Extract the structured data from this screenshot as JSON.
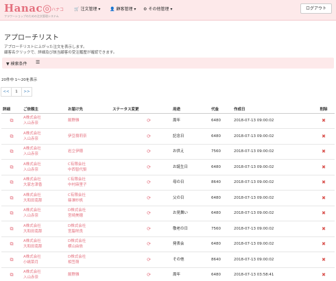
{
  "header": {
    "logo": "Hanac◎",
    "logo_kana": "ハナコ",
    "logo_sub": "フラワーショップのための注文管理システム",
    "nav": [
      {
        "label": "注文管理",
        "icon": "cart-icon",
        "glyph": "🛒"
      },
      {
        "label": "顧客管理",
        "icon": "user-icon",
        "glyph": "👤"
      },
      {
        "label": "その他管理",
        "icon": "gear-icon",
        "glyph": "⚙"
      }
    ],
    "logout": "ログアウト"
  },
  "page": {
    "title": "アプローチリスト",
    "desc1": "アプローチリストに上がった注文を表示します。",
    "desc2": "顧客名クリックで、詳細及び該当顧客の受注履歴が確認できます。"
  },
  "search": {
    "label": "検索条件"
  },
  "count": "20件中 1〜20を表示",
  "pager": [
    "<<",
    "1",
    ">>"
  ],
  "table": {
    "headers": [
      "詳細",
      "ご依頼主",
      "お届け先",
      "ステータス変更",
      "用途",
      "代金",
      "作成日",
      "削除"
    ],
    "rows": [
      {
        "client1": "A株式会社",
        "client2": "入山赤奈",
        "dest1": "",
        "dest2": "飯野雅",
        "purpose": "周年",
        "price": "6480",
        "date": "2018-07-13 09:00:02"
      },
      {
        "client1": "A株式会社",
        "client2": "入山赤奈",
        "dest1": "",
        "dest2": "伊豆樹莉奈",
        "purpose": "記念日",
        "price": "6480",
        "date": "2018-07-13 09:00:02"
      },
      {
        "client1": "A株式会社",
        "client2": "入山赤奈",
        "dest1": "",
        "dest2": "岩立伊穂",
        "purpose": "お供え",
        "price": "7560",
        "date": "2018-07-13 09:00:02"
      },
      {
        "client1": "A株式会社",
        "client2": "入山赤奈",
        "dest1": "C有限会社",
        "dest2": "中西智代梨",
        "purpose": "お誕生日",
        "price": "6480",
        "date": "2018-07-13 09:00:02"
      },
      {
        "client1": "A株式会社",
        "client2": "大家志津香",
        "dest1": "C有限会社",
        "dest2": "中村麻里子",
        "purpose": "母の日",
        "price": "8640",
        "date": "2018-07-13 09:00:02"
      },
      {
        "client1": "A株式会社",
        "client2": "大和田南那",
        "dest1": "C有限会社",
        "dest2": "篠澤紗帆",
        "purpose": "父の日",
        "price": "6480",
        "date": "2018-07-13 09:00:02"
      },
      {
        "client1": "A株式会社",
        "client2": "入山赤奈",
        "dest1": "D株式会社",
        "dest2": "宮崎美穂",
        "purpose": "お見舞い",
        "price": "6480",
        "date": "2018-07-13 09:00:02"
      },
      {
        "client1": "A株式会社",
        "client2": "大和田南那",
        "dest1": "D株式会社",
        "dest2": "宮脇咲良",
        "purpose": "敬老の日",
        "price": "7560",
        "date": "2018-07-13 09:00:02"
      },
      {
        "client1": "A株式会社",
        "client2": "大和田南那",
        "dest1": "D株式会社",
        "dest2": "横山由依",
        "purpose": "発表会",
        "price": "6480",
        "date": "2018-07-13 09:00:02"
      },
      {
        "client1": "A株式会社",
        "client2": "小嶋菜月",
        "dest1": "D株式会社",
        "dest2": "相笠萌",
        "purpose": "その他",
        "price": "8640",
        "date": "2018-07-13 09:00:02"
      },
      {
        "client1": "A株式会社",
        "client2": "入山赤奈",
        "dest1": "",
        "dest2": "飯野雅",
        "purpose": "周年",
        "price": "6480",
        "date": "2018-07-13 03:58:41"
      }
    ]
  },
  "icons": {
    "detail": "edit-icon",
    "status": "refresh-icon",
    "delete": "delete-icon",
    "chevron": "chevron-down-icon",
    "list": "list-icon"
  },
  "colors": {
    "accent": "#e4707e",
    "header_bg": "#fde9ea",
    "delete": "#d9534f"
  }
}
